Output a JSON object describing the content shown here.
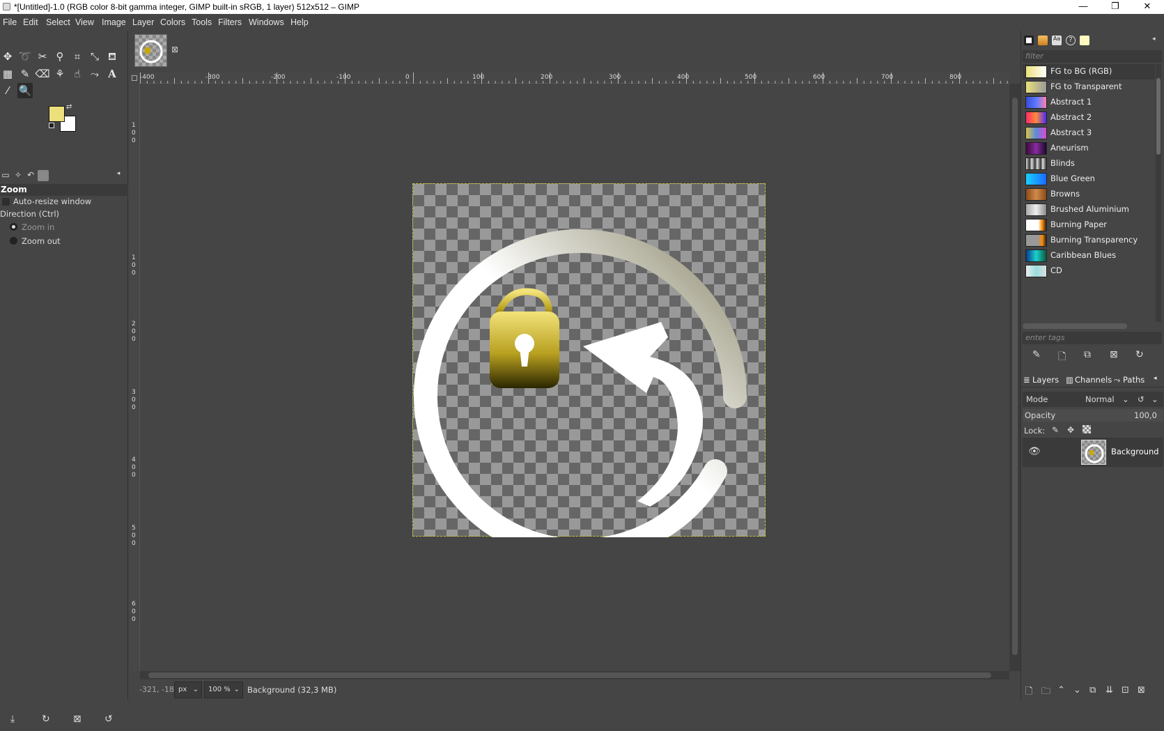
{
  "window": {
    "title": "*[Untitled]-1.0 (RGB color 8-bit gamma integer, GIMP built-in sRGB, 1 layer) 512x512 – GIMP",
    "minimize": "—",
    "maximize": "❐",
    "close": "✕"
  },
  "menu": [
    "File",
    "Edit",
    "Select",
    "View",
    "Image",
    "Layer",
    "Colors",
    "Tools",
    "Filters",
    "Windows",
    "Help"
  ],
  "tool_options": {
    "header": "Zoom",
    "auto_resize": "Auto-resize window",
    "direction_label": "Direction  (Ctrl)",
    "zoom_in": "Zoom in",
    "zoom_out": "Zoom out"
  },
  "colors": {
    "fg": "#ebe07c",
    "bg": "#ffffff"
  },
  "hruler_labels": [
    "-400",
    "-300",
    "-200",
    "-100",
    "0",
    "100",
    "200",
    "300",
    "400",
    "500",
    "600",
    "700",
    "800"
  ],
  "vruler_labels": [
    "1",
    "0",
    "0",
    "1",
    "0",
    "0",
    "2",
    "0",
    "0",
    "3",
    "0",
    "0",
    "4",
    "0",
    "0",
    "5",
    "0",
    "0",
    "6",
    "0",
    "0"
  ],
  "status": {
    "coords": "-321, -18",
    "unit": "px",
    "zoom": "100 %",
    "message": "Background (32,3 MB)"
  },
  "gradients": {
    "filter_placeholder": "filter",
    "tags_placeholder": "enter tags",
    "items": [
      {
        "name": "FG to BG (RGB)",
        "colors": "linear-gradient(90deg,#ebe07c,#ffffff)"
      },
      {
        "name": "FG to Transparent",
        "colors": "linear-gradient(90deg,#ebe07c,#999)"
      },
      {
        "name": "Abstract 1",
        "colors": "linear-gradient(90deg,#3b4bd8,#5a7cff,#ff7fb2)"
      },
      {
        "name": "Abstract 2",
        "colors": "linear-gradient(90deg,#ff2a6a,#ff8a3a,#4b2aff)"
      },
      {
        "name": "Abstract 3",
        "colors": "linear-gradient(90deg,#d9c24a,#5a8ad9,#d94ad0)"
      },
      {
        "name": "Aneurism",
        "colors": "linear-gradient(90deg,#3a0a3a,#8a2aa0,#1a0a2a)"
      },
      {
        "name": "Blinds",
        "colors": "repeating-linear-gradient(90deg,#ddd 0,#333 5px,#ddd 8px)"
      },
      {
        "name": "Blue Green",
        "colors": "linear-gradient(90deg,#1ad0ff,#1a6aff)"
      },
      {
        "name": "Browns",
        "colors": "linear-gradient(90deg,#8a4a1a,#d08a4a,#8a4a1a)"
      },
      {
        "name": "Brushed Aluminium",
        "colors": "linear-gradient(90deg,#aaa,#eee,#888)"
      },
      {
        "name": "Burning Paper",
        "colors": "linear-gradient(90deg,#fff 60%,#ff8a00,#222)"
      },
      {
        "name": "Burning Transparency",
        "colors": "linear-gradient(90deg,#999 60%,#ff8a00,#222)"
      },
      {
        "name": "Caribbean Blues",
        "colors": "linear-gradient(90deg,#0a3a8a,#1ad0d0,#0a5a3a)"
      },
      {
        "name": "CD",
        "colors": "linear-gradient(90deg,#eee,#9dd,#ddd)"
      }
    ]
  },
  "layers_panel": {
    "tabs": [
      "Layers",
      "Channels",
      "Paths"
    ],
    "mode_label": "Mode",
    "mode_value": "Normal",
    "opacity_label": "Opacity",
    "opacity_value": "100,0",
    "lock_label": "Lock:",
    "layer_name": "Background"
  }
}
